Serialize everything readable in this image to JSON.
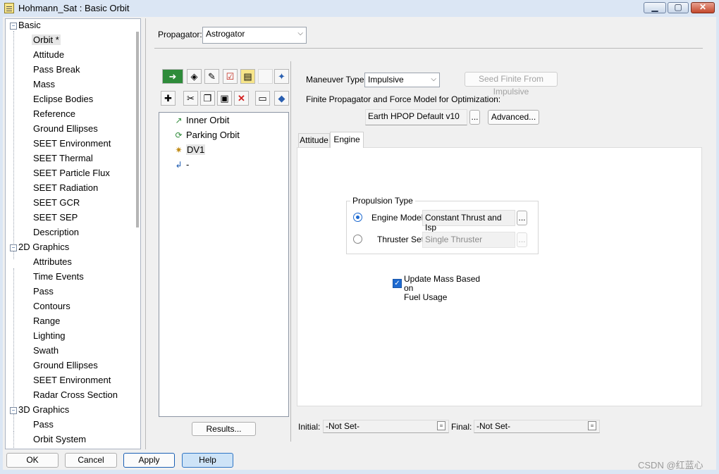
{
  "window": {
    "title": "Hohmann_Sat : Basic Orbit",
    "min_label": "▁",
    "max_label": "▢",
    "close_label": "✕"
  },
  "tree": {
    "items": [
      {
        "type": "cat",
        "label": "Basic",
        "sign": "−"
      },
      {
        "type": "leaf",
        "label": "Orbit *",
        "selected": true
      },
      {
        "type": "leaf",
        "label": "Attitude"
      },
      {
        "type": "leaf",
        "label": "Pass Break"
      },
      {
        "type": "leaf",
        "label": "Mass"
      },
      {
        "type": "leaf",
        "label": "Eclipse Bodies"
      },
      {
        "type": "leaf",
        "label": "Reference"
      },
      {
        "type": "leaf",
        "label": "Ground Ellipses"
      },
      {
        "type": "leaf",
        "label": "SEET Environment"
      },
      {
        "type": "leaf",
        "label": "SEET Thermal"
      },
      {
        "type": "leaf",
        "label": "SEET Particle Flux"
      },
      {
        "type": "leaf",
        "label": "SEET Radiation"
      },
      {
        "type": "leaf",
        "label": "SEET GCR"
      },
      {
        "type": "leaf",
        "label": "SEET SEP"
      },
      {
        "type": "leaf",
        "label": "Description"
      },
      {
        "type": "cat",
        "label": "2D Graphics",
        "sign": "−"
      },
      {
        "type": "leaf",
        "label": "Attributes"
      },
      {
        "type": "leaf",
        "label": "Time Events"
      },
      {
        "type": "leaf",
        "label": "Pass"
      },
      {
        "type": "leaf",
        "label": "Contours"
      },
      {
        "type": "leaf",
        "label": "Range"
      },
      {
        "type": "leaf",
        "label": "Lighting"
      },
      {
        "type": "leaf",
        "label": "Swath"
      },
      {
        "type": "leaf",
        "label": "Ground Ellipses"
      },
      {
        "type": "leaf",
        "label": "SEET Environment"
      },
      {
        "type": "leaf",
        "label": "Radar Cross Section"
      },
      {
        "type": "cat",
        "label": "3D Graphics",
        "sign": "−"
      },
      {
        "type": "leaf",
        "label": "Pass"
      },
      {
        "type": "leaf",
        "label": "Orbit System"
      }
    ]
  },
  "propagator": {
    "label": "Propagator:",
    "value": "Astrogator"
  },
  "toolbar": {
    "row1": [
      {
        "name": "insert-segment-icon",
        "glyph": "➜"
      },
      {
        "name": "eraser-icon",
        "glyph": "◈"
      },
      {
        "name": "wand-icon",
        "glyph": "✎"
      },
      {
        "name": "checklist-icon",
        "glyph": "☑"
      },
      {
        "name": "notes-icon",
        "glyph": "▤"
      },
      {
        "name": "blank-icon",
        "glyph": ""
      },
      {
        "name": "target-icon",
        "glyph": "✦"
      }
    ],
    "row2": [
      {
        "name": "new-icon",
        "glyph": "✚"
      },
      {
        "name": "cut-icon",
        "glyph": "✂"
      },
      {
        "name": "copy-icon",
        "glyph": "❐"
      },
      {
        "name": "paste-icon",
        "glyph": "▣"
      },
      {
        "name": "delete-icon",
        "glyph": "✕"
      },
      {
        "name": "run-icon",
        "glyph": "▭"
      },
      {
        "name": "diamond-icon",
        "glyph": "◆"
      }
    ]
  },
  "sequence": {
    "items": [
      {
        "label": "Inner Orbit",
        "icon": "initial-state-icon",
        "glyph": "↗"
      },
      {
        "label": "Parking Orbit",
        "icon": "propagate-icon",
        "glyph": "⟳"
      },
      {
        "label": "DV1",
        "icon": "maneuver-icon",
        "glyph": "✷",
        "selected": true
      },
      {
        "label": "-",
        "icon": "return-icon",
        "glyph": "↲"
      }
    ],
    "results_label": "Results..."
  },
  "maneuver": {
    "type_label": "Maneuver Type:",
    "type_value": "Impulsive",
    "seed_label": "Seed Finite From Impulsive",
    "finite_label": "Finite Propagator and Force Model for Optimization:",
    "force_model": "Earth HPOP Default v10",
    "dots": "...",
    "advanced_label": "Advanced..."
  },
  "tabs": {
    "attitude": "Attitude",
    "engine": "Engine"
  },
  "propulsion": {
    "title": "Propulsion Type",
    "engine_model_label": "Engine Model",
    "engine_model_value": "Constant Thrust and Isp",
    "thruster_set_label": "Thruster Set",
    "thruster_set_value": "Single Thruster",
    "selected": "engine_model"
  },
  "update_mass": {
    "label_line1": "Update Mass Based on",
    "label_line2": "Fuel Usage",
    "checked": true,
    "check_glyph": "✓"
  },
  "initial": {
    "label": "Initial:",
    "value": "-Not Set-"
  },
  "final": {
    "label": "Final:",
    "value": "-Not Set-"
  },
  "buttons": {
    "ok": "OK",
    "cancel": "Cancel",
    "apply": "Apply",
    "help": "Help"
  },
  "watermark": "CSDN @红蓝心"
}
